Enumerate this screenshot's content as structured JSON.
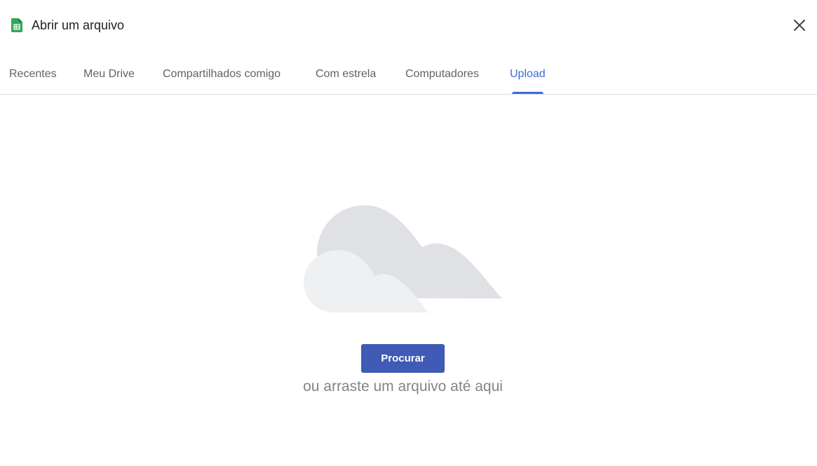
{
  "header": {
    "title": "Abrir um arquivo",
    "app_icon": "sheets-icon",
    "close_icon": "close-icon"
  },
  "tabs": [
    {
      "label": "Recentes",
      "active": false
    },
    {
      "label": "Meu Drive",
      "active": false
    },
    {
      "label": "Compartilhados comigo",
      "active": false
    },
    {
      "label": "Com estrela",
      "active": false
    },
    {
      "label": "Computadores",
      "active": false
    },
    {
      "label": "Upload",
      "active": true
    }
  ],
  "upload": {
    "illustration": "cloud-illustration",
    "browse_label": "Procurar",
    "drop_hint": "ou arraste um arquivo até aqui"
  },
  "colors": {
    "accent": "#3f6bd8",
    "button": "#3f5bb5",
    "sheets_green": "#34a853",
    "cloud_back": "#e0e1e4",
    "cloud_front": "#eff0f1"
  }
}
